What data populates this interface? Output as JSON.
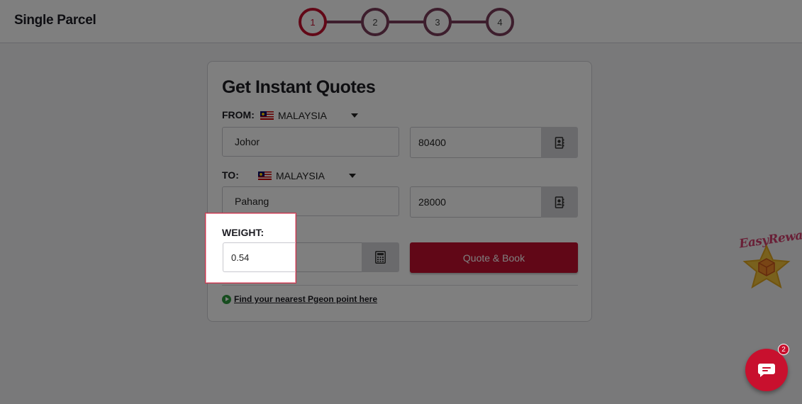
{
  "header": {
    "title": "Single Parcel",
    "steps": [
      "1",
      "2",
      "3",
      "4"
    ],
    "active_step": "1"
  },
  "quote_form": {
    "title": "Get Instant Quotes",
    "from": {
      "label": "FROM:",
      "country": "MALAYSIA",
      "state": "Johor",
      "postcode": "80400"
    },
    "to": {
      "label": "TO:",
      "country": "MALAYSIA",
      "state": "Pahang",
      "postcode": "28000"
    },
    "weight": {
      "label": "WEIGHT:",
      "value": "0.54"
    },
    "submit_label": "Quote & Book",
    "pgeon_link": "Find your nearest Pgeon point here"
  },
  "widgets": {
    "easy_reward_text": "EasyReward",
    "chat_unread_count": "2"
  },
  "colors": {
    "brand_red": "#c30e2e",
    "step_border": "#7a3d5a",
    "overlay": "rgba(0,0,0,0.5)"
  },
  "icons": {
    "address_book": "address-book-icon",
    "calculator": "calculator-icon",
    "dropdown": "chevron-down-icon",
    "location": "location-play-icon",
    "chat": "chat-icon"
  }
}
